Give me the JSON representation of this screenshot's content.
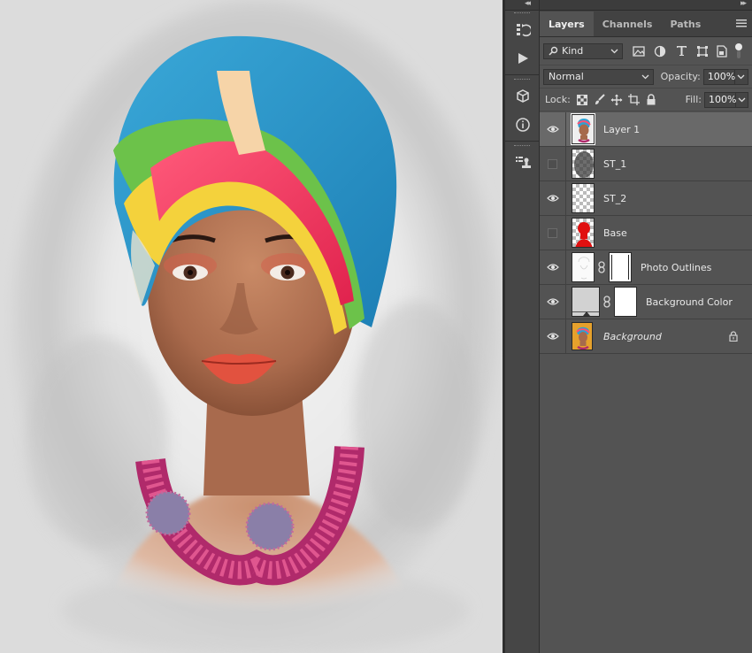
{
  "panel": {
    "tabs": [
      {
        "label": "Layers",
        "active": true
      },
      {
        "label": "Channels",
        "active": false
      },
      {
        "label": "Paths",
        "active": false
      }
    ],
    "filter": {
      "label": "Kind",
      "icon": "search-icon"
    },
    "blend_mode": "Normal",
    "opacity_label": "Opacity:",
    "opacity_value": "100%",
    "lock_label": "Lock:",
    "fill_label": "Fill:",
    "fill_value": "100%"
  },
  "layers": [
    {
      "name": "Layer 1",
      "visible": true,
      "selected": true,
      "italic": false,
      "locked": false
    },
    {
      "name": "ST_1",
      "visible": false,
      "selected": false,
      "italic": false,
      "locked": false
    },
    {
      "name": "ST_2",
      "visible": true,
      "selected": false,
      "italic": false,
      "locked": false
    },
    {
      "name": "Base",
      "visible": false,
      "selected": false,
      "italic": false,
      "locked": false
    },
    {
      "name": "Photo Outlines",
      "visible": true,
      "selected": false,
      "italic": false,
      "locked": false
    },
    {
      "name": "Background Color",
      "visible": true,
      "selected": false,
      "italic": false,
      "locked": false
    },
    {
      "name": "Background",
      "visible": true,
      "selected": false,
      "italic": true,
      "locked": true
    }
  ],
  "colors": {
    "panel_bg": "#535353",
    "selected_layer": "#696969",
    "canvas_bg": "#dcdcdc",
    "base_layer_red": "#e01010"
  }
}
